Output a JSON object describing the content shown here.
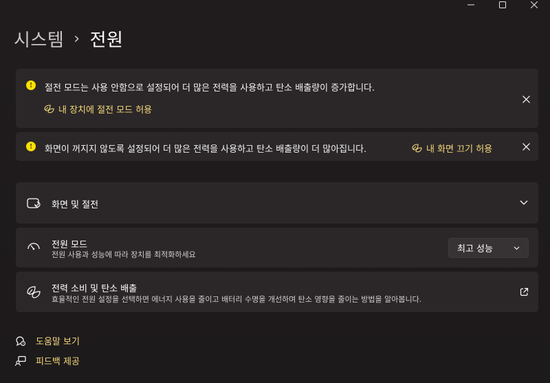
{
  "window_controls": {
    "minimize": "minimize-icon",
    "maximize": "maximize-icon",
    "close": "close-icon"
  },
  "header": {
    "parent": "시스템",
    "separator": "›",
    "current": "전원"
  },
  "banners": [
    {
      "icon": "info-icon",
      "icon_glyph": "!",
      "text": "절전 모드는 사용 안함으로 설정되어 더 많은 전력을 사용하고 탄소 배출량이 증가합니다.",
      "link_icon": "leaf-icon",
      "link": "내 장치에 절전 모드 허용"
    },
    {
      "icon": "info-icon",
      "icon_glyph": "!",
      "text": "화면이 꺼지지 않도록 설정되어 더 많은 전력을 사용하고 탄소 배출량이 더 많아집니다.",
      "link_icon": "leaf-icon",
      "link": "내 화면 끄기 허용"
    }
  ],
  "cards": {
    "display": {
      "icon": "display-sleep-icon",
      "title": "화면 및 절전",
      "chevron": "chevron-down-icon"
    },
    "power_mode": {
      "icon": "speedometer-icon",
      "title": "전원 모드",
      "subtitle": "전원 사용과 성능에 따라 장치를 최적화하세요",
      "selected": "최고 성능"
    },
    "carbon": {
      "icon": "leaf-icon",
      "title": "전력 소비 및 탄소 배출",
      "subtitle": "효율적인 전원 설정을 선택하면 에너지 사용을 줄이고 배터리 수명을 개선하며 탄소 영향을 줄이는 방법을 알아봅니다.",
      "action_icon": "external-link-icon"
    }
  },
  "footer": [
    {
      "icon": "help-icon",
      "label": "도움말 보기"
    },
    {
      "icon": "feedback-icon",
      "label": "피드백 제공"
    }
  ],
  "colors": {
    "background": "#1f1b1c",
    "card": "#2b2728",
    "accent_link": "#f2d87a",
    "warning": "#fce100"
  }
}
